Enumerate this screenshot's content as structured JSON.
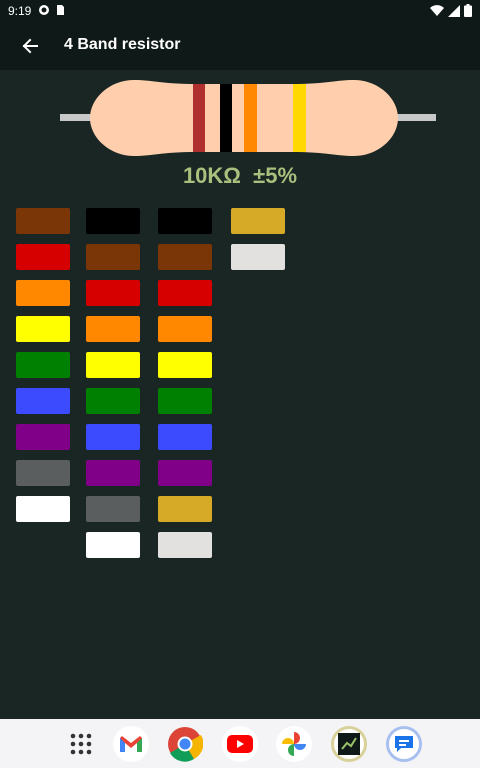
{
  "status_bar": {
    "time": "9:19"
  },
  "app_bar": {
    "title": "4 Band resistor"
  },
  "resistor": {
    "body_color": "#ffcfad",
    "lead_color": "#c7c9c8",
    "bands": [
      "#b03030",
      "#000000",
      "#ff8800",
      "#ffd800"
    ]
  },
  "result": {
    "resistance": "10KΩ",
    "tolerance": "±5%"
  },
  "columns": [
    {
      "name": "first-digit",
      "colors": [
        "#7b3608",
        "#d60000",
        "#ff8800",
        "#ffff00",
        "#008000",
        "#3d4bff",
        "#800088",
        "#5b5e5e",
        "#ffffff"
      ]
    },
    {
      "name": "second-digit",
      "colors": [
        "#000000",
        "#7b3608",
        "#d60000",
        "#ff8800",
        "#ffff00",
        "#008000",
        "#3d4bff",
        "#800088",
        "#5b5e5e",
        "#ffffff"
      ]
    },
    {
      "name": "multiplier",
      "colors": [
        "#000000",
        "#7b3608",
        "#d60000",
        "#ff8800",
        "#ffff00",
        "#008000",
        "#3d4bff",
        "#800088",
        "#d6aa26",
        "#e3e1df"
      ]
    },
    {
      "name": "tolerance",
      "colors": [
        "#d6aa26",
        "#e3e1df"
      ]
    }
  ],
  "dock": [
    {
      "name": "apps-grid-icon"
    },
    {
      "name": "gmail-icon"
    },
    {
      "name": "chrome-icon"
    },
    {
      "name": "youtube-icon"
    },
    {
      "name": "photos-icon"
    },
    {
      "name": "resistor-app-icon"
    },
    {
      "name": "messages-icon"
    }
  ]
}
